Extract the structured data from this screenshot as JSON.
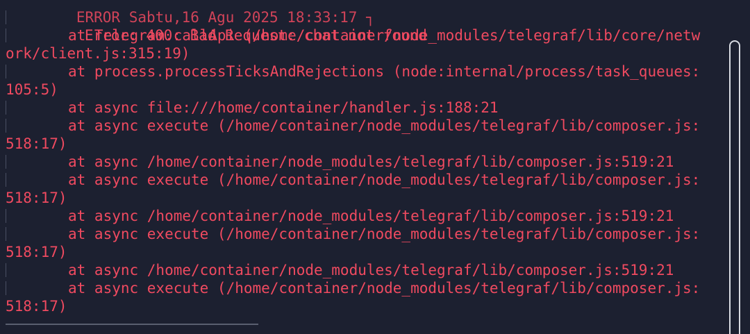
{
  "terminal": {
    "header": "ERROR Sabtu,16 Agu 2025 18:33:17 ┐",
    "error_message": "Error: 400: Bad Request: chat not found",
    "lines": [
      {
        "kind": "frame",
        "text": "at Telegram.callApi (/home/container/node_modules/telegraf/lib/core/netw"
      },
      {
        "kind": "wrap",
        "text": "ork/client.js:315:19)"
      },
      {
        "kind": "frame",
        "text": "at process.processTicksAndRejections (node:internal/process/task_queues:"
      },
      {
        "kind": "wrap",
        "text": "105:5)"
      },
      {
        "kind": "frame",
        "text": "at async file:///home/container/handler.js:188:21"
      },
      {
        "kind": "frame",
        "text": "at async execute (/home/container/node_modules/telegraf/lib/composer.js:"
      },
      {
        "kind": "wrap",
        "text": "518:17)"
      },
      {
        "kind": "frame",
        "text": "at async /home/container/node_modules/telegraf/lib/composer.js:519:21"
      },
      {
        "kind": "frame",
        "text": "at async execute (/home/container/node_modules/telegraf/lib/composer.js:"
      },
      {
        "kind": "wrap",
        "text": "518:17)"
      },
      {
        "kind": "frame",
        "text": "at async /home/container/node_modules/telegraf/lib/composer.js:519:21"
      },
      {
        "kind": "frame",
        "text": "at async execute (/home/container/node_modules/telegraf/lib/composer.js:"
      },
      {
        "kind": "wrap",
        "text": "518:17)"
      },
      {
        "kind": "frame",
        "text": "at async /home/container/node_modules/telegraf/lib/composer.js:519:21"
      },
      {
        "kind": "frame",
        "text": "at async execute (/home/container/node_modules/telegraf/lib/composer.js:"
      },
      {
        "kind": "wrap",
        "text": "518:17)"
      }
    ]
  },
  "colors": {
    "background": "#1c2030",
    "error_text": "#f04a60"
  }
}
